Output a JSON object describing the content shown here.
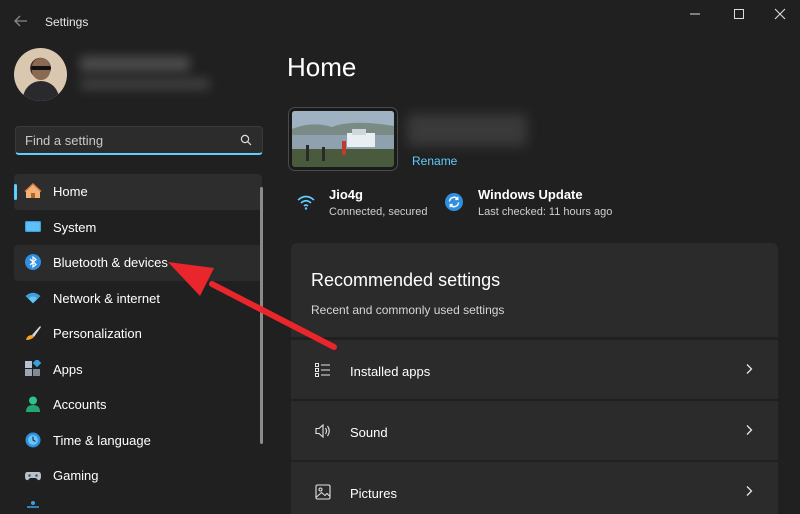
{
  "window": {
    "title": "Settings"
  },
  "search": {
    "placeholder": "Find a setting"
  },
  "nav": {
    "items": [
      {
        "label": "Home",
        "icon": "home-icon"
      },
      {
        "label": "System",
        "icon": "system-icon"
      },
      {
        "label": "Bluetooth & devices",
        "icon": "bluetooth-icon"
      },
      {
        "label": "Network & internet",
        "icon": "wifi-icon"
      },
      {
        "label": "Personalization",
        "icon": "brush-icon"
      },
      {
        "label": "Apps",
        "icon": "apps-icon"
      },
      {
        "label": "Accounts",
        "icon": "accounts-icon"
      },
      {
        "label": "Time & language",
        "icon": "clock-globe-icon"
      },
      {
        "label": "Gaming",
        "icon": "gamepad-icon"
      }
    ],
    "selected": "Home",
    "hovered": "Bluetooth & devices"
  },
  "main": {
    "title": "Home",
    "rename_label": "Rename",
    "network": {
      "name": "Jio4g",
      "status": "Connected, secured"
    },
    "update": {
      "name": "Windows Update",
      "status": "Last checked: 11 hours ago"
    },
    "recommended": {
      "title": "Recommended settings",
      "subtitle": "Recent and commonly used settings",
      "items": [
        {
          "label": "Installed apps",
          "icon": "list-icon"
        },
        {
          "label": "Sound",
          "icon": "speaker-icon"
        },
        {
          "label": "Pictures",
          "icon": "picture-icon"
        }
      ]
    }
  },
  "colors": {
    "accent": "#60cdff",
    "background": "#202020",
    "card": "#2b2b2b",
    "annotation_arrow": "#e8262b"
  }
}
